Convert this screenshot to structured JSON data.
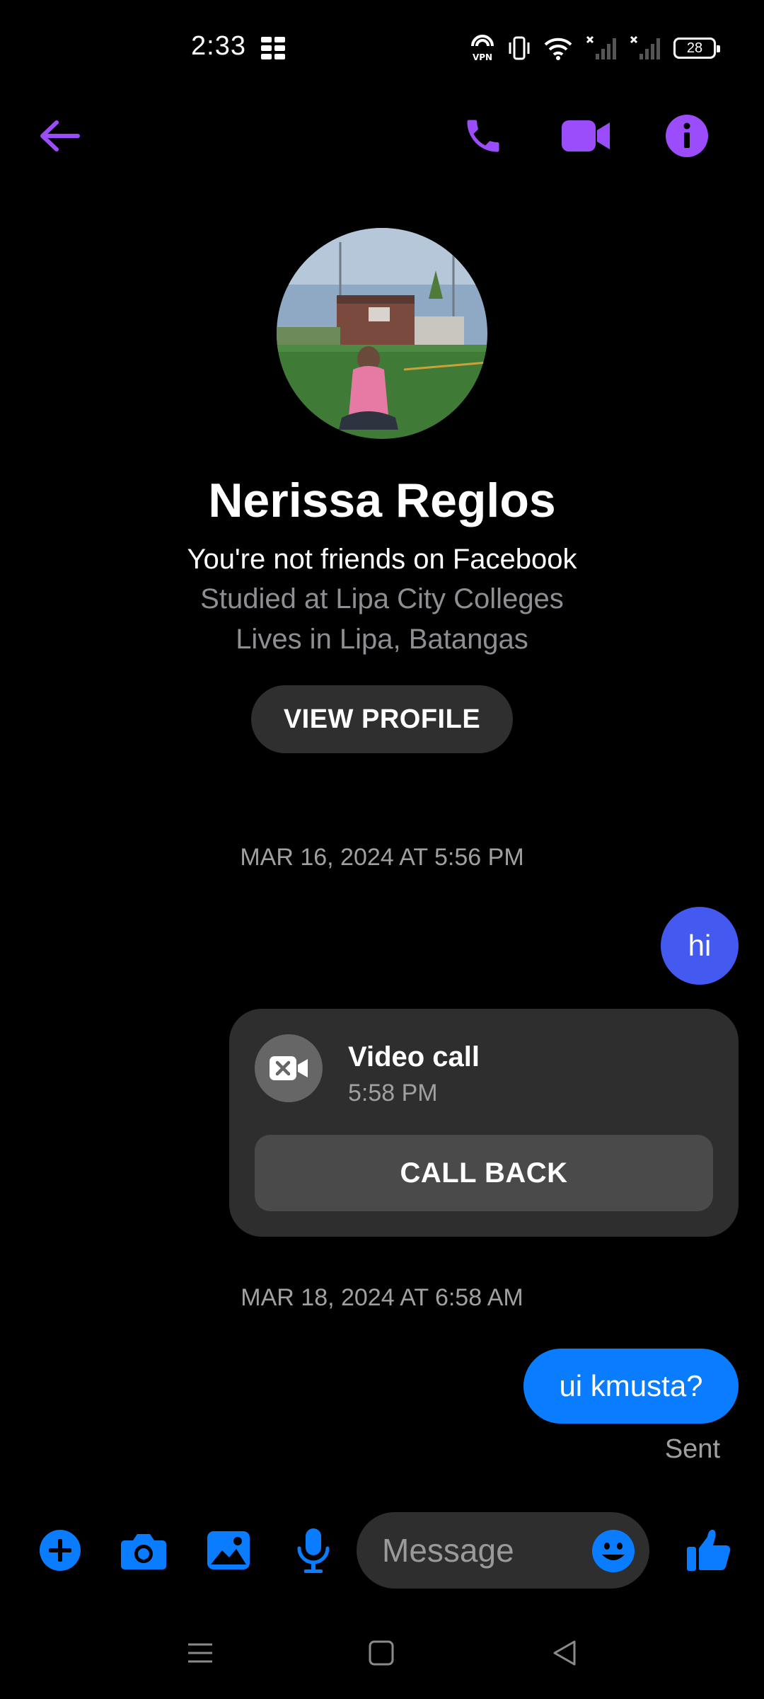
{
  "status_bar": {
    "time": "2:33",
    "battery": "28",
    "icons": [
      "grid-app-icon",
      "vpn-icon",
      "vibrate-icon",
      "wifi-icon",
      "signal-off-icon",
      "signal-off-icon",
      "battery-icon"
    ]
  },
  "header": {
    "icons": [
      "back-arrow-icon",
      "phone-icon",
      "video-camera-icon",
      "info-icon"
    ],
    "accent_color": "#9b4dfc"
  },
  "profile": {
    "name": "Nerissa Reglos",
    "friend_status": "You're not friends on Facebook",
    "studied": "Studied at Lipa City Colleges",
    "lives": "Lives in Lipa, Batangas",
    "view_profile_label": "VIEW PROFILE"
  },
  "conversation": {
    "timestamp_1": "MAR 16, 2024 AT 5:56 PM",
    "message_1": "hi",
    "call": {
      "title": "Video call",
      "time": "5:58 PM",
      "call_back_label": "CALL BACK"
    },
    "timestamp_2": "MAR 18, 2024 AT 6:58 AM",
    "message_2": "ui kmusta?",
    "sent_status": "Sent"
  },
  "composer": {
    "placeholder": "Message",
    "icons": [
      "plus-icon",
      "camera-icon",
      "gallery-icon",
      "microphone-icon",
      "emoji-icon",
      "thumbs-up-icon"
    ],
    "accent_color": "#0a7cff"
  },
  "colors": {
    "bubble_purple": "#4459f0",
    "bubble_blue": "#0a7cff",
    "background": "#000000"
  }
}
